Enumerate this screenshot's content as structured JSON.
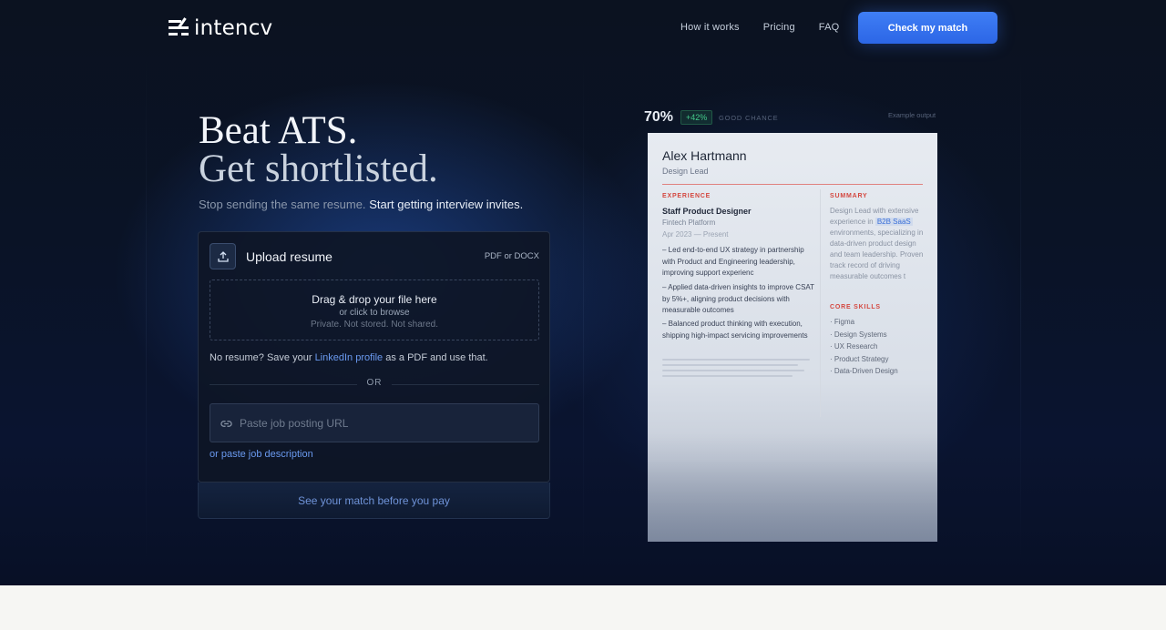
{
  "brand": {
    "name": "intencv"
  },
  "nav": {
    "items": [
      "How it works",
      "Pricing",
      "FAQ"
    ],
    "cta": "Check my match"
  },
  "hero": {
    "title_line1": "Beat ATS.",
    "title_line2": "Get shortlisted.",
    "subtitle_muted": "Stop sending the same resume.",
    "subtitle_strong": "Start getting interview invites."
  },
  "upload": {
    "title": "Upload resume",
    "formats": "PDF or DOCX",
    "drop_title": "Drag & drop your file here",
    "drop_sub": "or click to browse",
    "drop_privacy": "Private. Not stored. Not shared.",
    "linkedin_pre": "No resume? Save your",
    "linkedin_link": "LinkedIn profile",
    "linkedin_post": "as a PDF and use that.",
    "or": "OR",
    "url_placeholder": "Paste job posting URL",
    "paste_desc": "or paste job description",
    "footer": "See your match before you pay"
  },
  "preview": {
    "score": "70%",
    "delta": "+42%",
    "chance": "GOOD CHANCE",
    "example": "Example output",
    "name": "Alex Hartmann",
    "role": "Design Lead",
    "experience_heading": "EXPERIENCE",
    "job_title": "Staff Product Designer",
    "company": "Fintech Platform",
    "dates": "Apr 2023 — Present",
    "bullets": [
      "– Led end-to-end UX strategy in partnership with Product and Engineering leadership, improving support experienc",
      "– Applied data-driven insights to improve CSAT by 5%+, aligning product decisions with measurable outcomes",
      "– Balanced product thinking with execution, shipping high-impact servicing improvements"
    ],
    "summary_heading": "SUMMARY",
    "summary_pre": "Design Lead with extensive experience in",
    "summary_highlight": "B2B SaaS",
    "summary_post": "environments, specializing in data-driven product design and team leadership. Proven track record of driving measurable outcomes t",
    "skills_heading": "CORE SKILLS",
    "skills": [
      "· Figma",
      "· Design Systems",
      "· UX Research",
      "· Product Strategy",
      "· Data-Driven Design"
    ]
  },
  "colors": {
    "accent": "#3f7ef5",
    "link": "#6a9af0",
    "resume_accent": "#d4473f",
    "positive": "#44c98a"
  }
}
